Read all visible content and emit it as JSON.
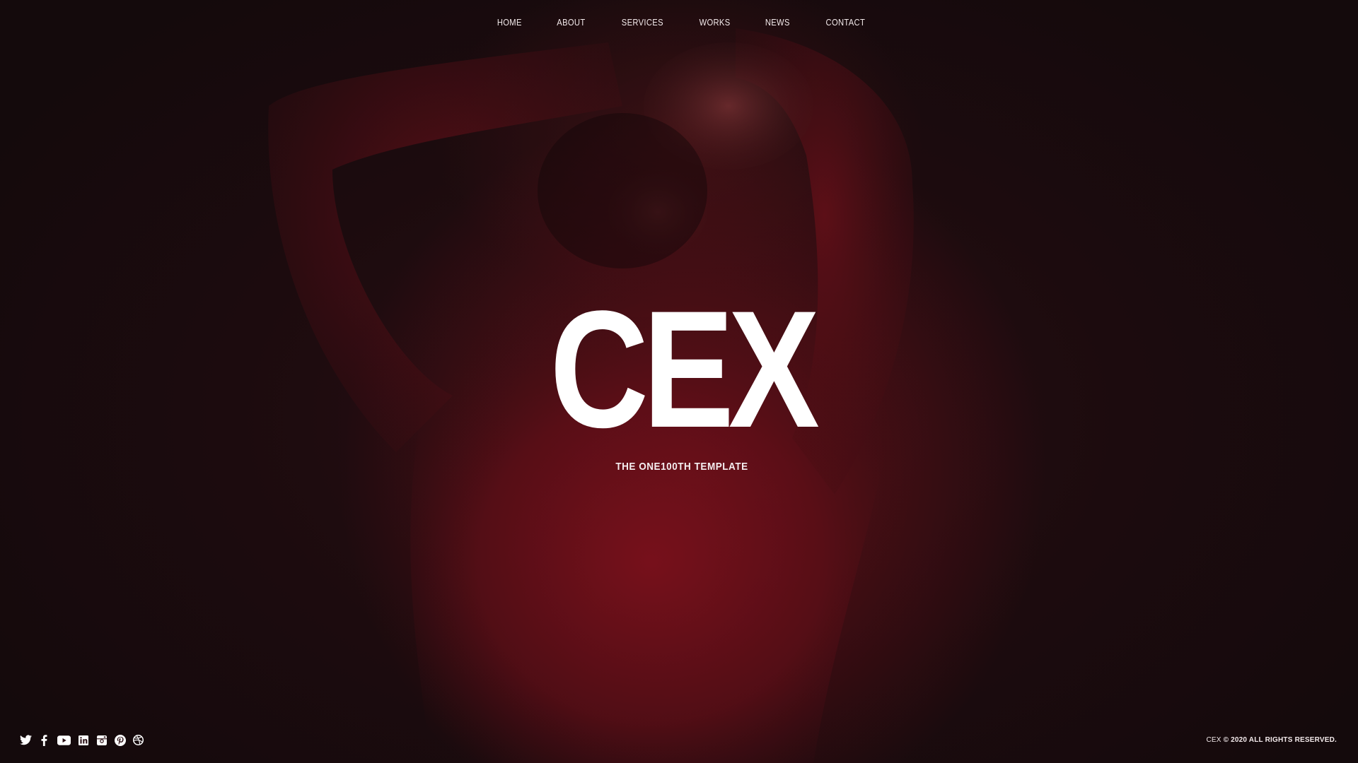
{
  "nav": {
    "items": [
      {
        "label": "HOME"
      },
      {
        "label": "ABOUT"
      },
      {
        "label": "SERVICES"
      },
      {
        "label": "WORKS"
      },
      {
        "label": "NEWS"
      },
      {
        "label": "CONTACT"
      }
    ]
  },
  "hero": {
    "title": "CEX",
    "subtitle": "THE ONE100TH TEMPLATE"
  },
  "social": {
    "icons": [
      "twitter-icon",
      "facebook-icon",
      "youtube-icon",
      "linkedin-icon",
      "instagram-icon",
      "pinterest-icon",
      "dribbble-icon"
    ]
  },
  "footer": {
    "brand": "CEX",
    "rights": "© 2020 ALL RIGHTS RESERVED."
  },
  "colors": {
    "background": "#1a0c0f",
    "accent_red": "#7a101a",
    "text": "#ffffff"
  }
}
